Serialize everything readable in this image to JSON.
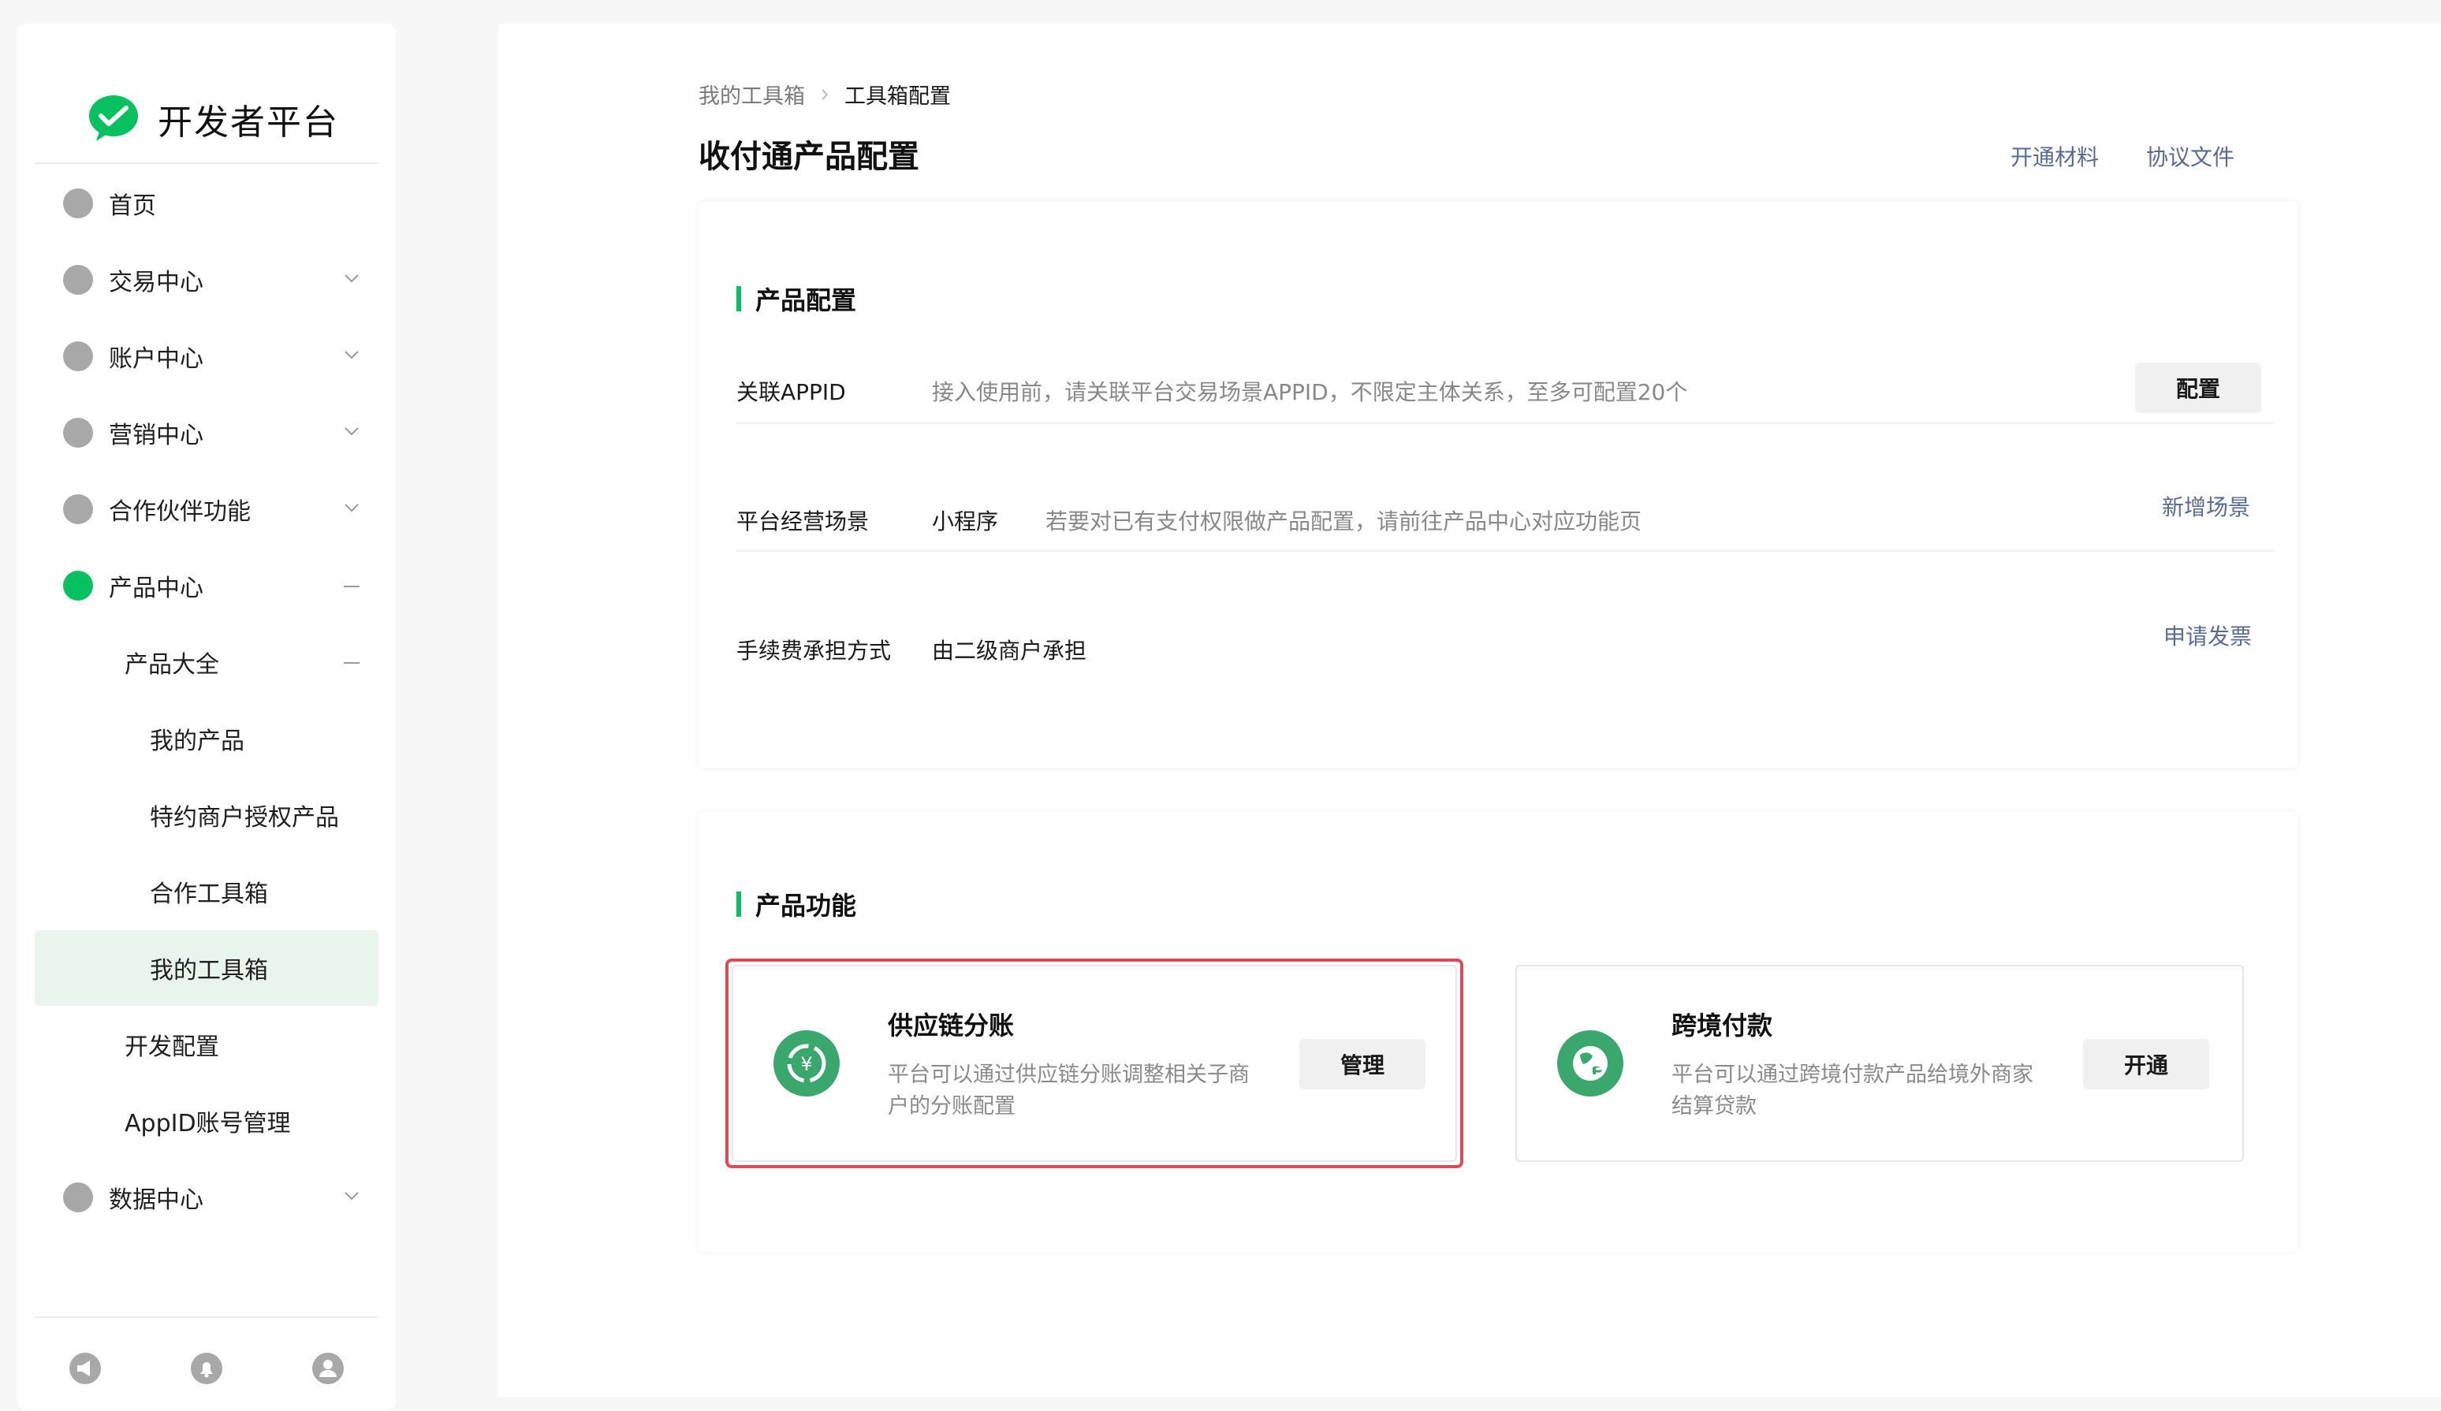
{
  "brand": {
    "name": "开发者平台",
    "logo": "wechat-logo-icon"
  },
  "sidebar": {
    "items": [
      {
        "label": "首页",
        "icon": "dot",
        "expand": ""
      },
      {
        "label": "交易中心",
        "icon": "dot",
        "expand": "chevron-down"
      },
      {
        "label": "账户中心",
        "icon": "dot",
        "expand": "chevron-down"
      },
      {
        "label": "营销中心",
        "icon": "dot",
        "expand": "chevron-down"
      },
      {
        "label": "合作伙伴功能",
        "icon": "dot",
        "expand": "chevron-down"
      },
      {
        "label": "产品中心",
        "icon": "dot-green",
        "expand": "collapse-dash"
      },
      {
        "label": "产品大全",
        "icon": "",
        "expand": "collapse-dash"
      },
      {
        "label": "我的产品",
        "icon": "",
        "expand": ""
      },
      {
        "label": "特约商户授权产品",
        "icon": "",
        "expand": ""
      },
      {
        "label": "合作工具箱",
        "icon": "",
        "expand": ""
      },
      {
        "label": "我的工具箱",
        "icon": "",
        "expand": "",
        "active": true
      },
      {
        "label": "开发配置",
        "icon": "",
        "expand": ""
      },
      {
        "label": "AppID账号管理",
        "icon": "",
        "expand": ""
      },
      {
        "label": "数据中心",
        "icon": "dot",
        "expand": "chevron-down"
      }
    ],
    "bottom_icons": [
      "announcement-icon",
      "bell-icon",
      "user-icon"
    ]
  },
  "breadcrumb": {
    "parent": "我的工具箱",
    "current": "工具箱配置"
  },
  "page": {
    "title": "收付通产品配置",
    "links": [
      "开通材料",
      "协议文件"
    ]
  },
  "product_config": {
    "header": "产品配置",
    "rows": [
      {
        "label": "关联APPID",
        "value": "",
        "hint": "接入使用前，请关联平台交易场景APPID，不限定主体关系，至多可配置20个",
        "action": "配置",
        "action_type": "button"
      },
      {
        "label": "平台经营场景",
        "value": "小程序",
        "hint": "若要对已有支付权限做产品配置，请前往产品中心对应功能页",
        "action": "新增场景",
        "action_type": "link"
      },
      {
        "label": "手续费承担方式",
        "value": "由二级商户承担",
        "hint": "",
        "action": "申请发票",
        "action_type": "link"
      }
    ]
  },
  "product_functions": {
    "header": "产品功能",
    "cards": [
      {
        "title": "供应链分账",
        "desc": "平台可以通过供应链分账调整相关子商户的分账配置",
        "button": "管理",
        "icon": "supply-chain-split-icon",
        "highlighted": true
      },
      {
        "title": "跨境付款",
        "desc": "平台可以通过跨境付款产品给境外商家结算贷款",
        "button": "开通",
        "icon": "cross-border-globe-icon",
        "highlighted": false
      }
    ]
  },
  "colors": {
    "accent_green": "#07c160",
    "link_blue": "#576b95",
    "highlight_red": "#e04a55"
  }
}
